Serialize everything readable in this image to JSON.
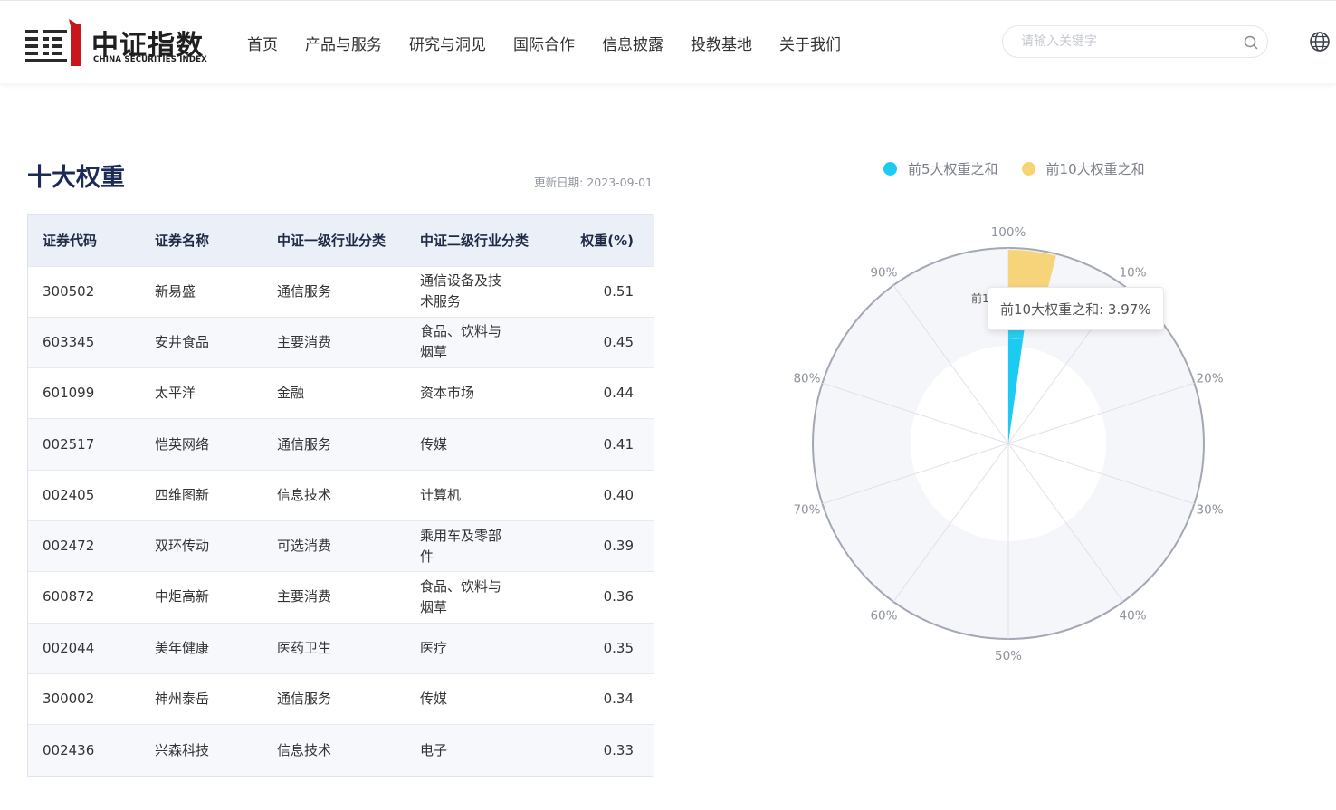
{
  "header": {
    "logo_cn": "中证指数",
    "logo_en": "CHINA SECURITIES INDEX",
    "nav": [
      "首页",
      "产品与服务",
      "研究与洞见",
      "国际合作",
      "信息披露",
      "投教基地",
      "关于我们"
    ],
    "search_placeholder": "请输入关键字"
  },
  "section": {
    "title": "十大权重",
    "update_date": "更新日期: 2023-09-01"
  },
  "table": {
    "columns": [
      "证券代码",
      "证券名称",
      "中证一级行业分类",
      "中证二级行业分类",
      "权重(%)"
    ],
    "rows": [
      [
        "300502",
        "新易盛",
        "通信服务",
        "通信设备及技术服务",
        "0.51"
      ],
      [
        "603345",
        "安井食品",
        "主要消费",
        "食品、饮料与烟草",
        "0.45"
      ],
      [
        "601099",
        "太平洋",
        "金融",
        "资本市场",
        "0.44"
      ],
      [
        "002517",
        "恺英网络",
        "通信服务",
        "传媒",
        "0.41"
      ],
      [
        "002405",
        "四维图新",
        "信息技术",
        "计算机",
        "0.40"
      ],
      [
        "002472",
        "双环传动",
        "可选消费",
        "乘用车及零部件",
        "0.39"
      ],
      [
        "600872",
        "中炬高新",
        "主要消费",
        "食品、饮料与烟草",
        "0.36"
      ],
      [
        "002044",
        "美年健康",
        "医药卫生",
        "医疗",
        "0.35"
      ],
      [
        "300002",
        "神州泰岳",
        "通信服务",
        "传媒",
        "0.34"
      ],
      [
        "002436",
        "兴森科技",
        "信息技术",
        "电子",
        "0.33"
      ]
    ]
  },
  "chart_data": {
    "type": "bar",
    "subtype": "polar-radial",
    "angle_axis": {
      "min": 0,
      "max": 100,
      "ticks": [
        "100%",
        "10%",
        "20%",
        "30%",
        "40%",
        "50%",
        "60%",
        "70%",
        "80%",
        "90%"
      ]
    },
    "series": [
      {
        "name": "前5大权重之和",
        "value": 2.21,
        "color": "#1ccbf2"
      },
      {
        "name": "前10大权重之和",
        "value": 3.97,
        "color": "#f6d373"
      }
    ],
    "legend_position": "top",
    "tooltip": "前10大权重之和: 3.97%",
    "partial_label": "前1"
  }
}
